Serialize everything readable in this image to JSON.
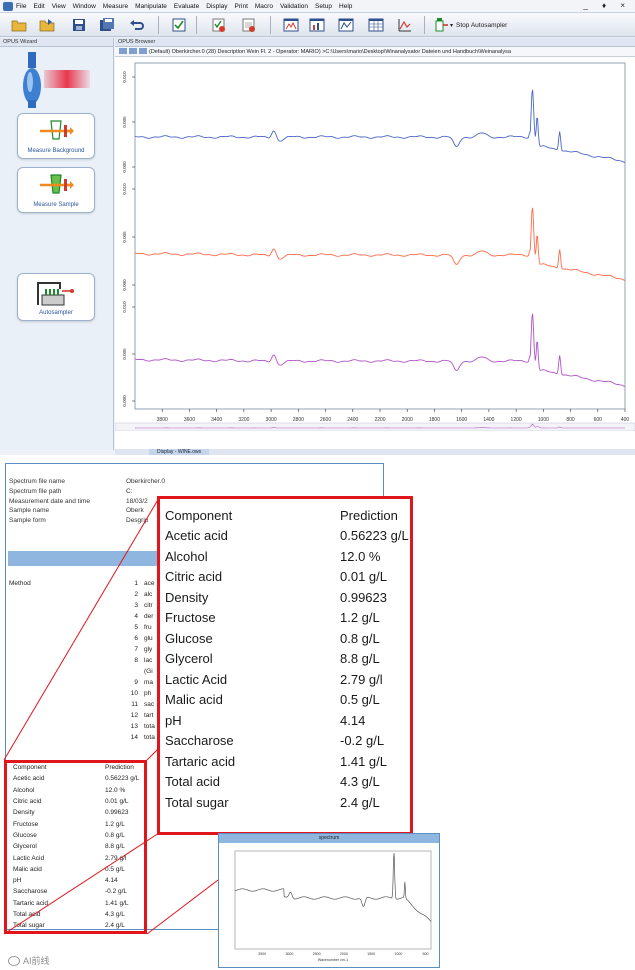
{
  "menu": {
    "items": [
      "File",
      "Edit",
      "View",
      "Window",
      "Measure",
      "Manipulate",
      "Evaluate",
      "Display",
      "Print",
      "Macro",
      "Validation",
      "Setup",
      "Help"
    ],
    "window_controls": "_ ♦ ×"
  },
  "toolbar": {
    "stop_autosampler": "Stop Autosampler"
  },
  "wizard": {
    "title": "OPUS Wizard",
    "buttons": [
      {
        "label": "Measure Background"
      },
      {
        "label": "Measure Sample"
      },
      {
        "label": "Autosampler"
      }
    ]
  },
  "browser": {
    "title": "OPUS Browser",
    "path": "(Default) Oberkircher.0 (28) Description Wein Fl. 2 - Operator: MARIO) >C:\\Users\\mario\\Desktop\\Winanalysator Dateien und Handbuch\\Weinanalysa"
  },
  "display_tab": "Display - WINE.ows",
  "chart_data": {
    "type": "line",
    "x_ticks": [
      3800,
      3600,
      3400,
      3200,
      3000,
      2800,
      2600,
      2400,
      2200,
      2000,
      1800,
      1600,
      1400,
      1200,
      1000,
      800,
      600,
      400
    ],
    "xlim": [
      4000,
      400
    ],
    "series": [
      {
        "color": "#4a66c8",
        "y_ticks": [
          "0.010",
          "0.005",
          "0.000"
        ]
      },
      {
        "color": "#ff6a4a",
        "y_ticks": [
          "0.010",
          "0.005",
          "0.000"
        ]
      },
      {
        "color": "#b154c7",
        "y_ticks": [
          "0.010",
          "0.005",
          "0.000"
        ]
      }
    ]
  },
  "report": {
    "meta_labels": [
      "Spectrum file name",
      "Spectrum file path",
      "Measurement date and time",
      "Sample name",
      "Sample form"
    ],
    "meta_values": [
      "Oberkircher.0",
      "C:",
      "18/03/2",
      "Oberk",
      "Desgrip"
    ],
    "method_label": "Method",
    "method_items": [
      {
        "num": "1",
        "text": "ace"
      },
      {
        "num": "2",
        "text": "alc"
      },
      {
        "num": "3",
        "text": "citr"
      },
      {
        "num": "4",
        "text": "der"
      },
      {
        "num": "5",
        "text": "fru"
      },
      {
        "num": "6",
        "text": "glu"
      },
      {
        "num": "7",
        "text": "gly"
      },
      {
        "num": "8",
        "text": "lac"
      },
      {
        "num": "",
        "text": "(Gi"
      },
      {
        "num": "9",
        "text": "ma"
      },
      {
        "num": "10",
        "text": "ph"
      },
      {
        "num": "11",
        "text": "sac"
      },
      {
        "num": "12",
        "text": "tart"
      },
      {
        "num": "13",
        "text": "tota"
      },
      {
        "num": "14",
        "text": "tota"
      }
    ]
  },
  "predictions": {
    "header": {
      "component": "Component",
      "prediction": "Prediction"
    },
    "rows": [
      {
        "component": "Acetic acid",
        "prediction": "0.56223 g/L"
      },
      {
        "component": "Alcohol",
        "prediction": "12.0 %"
      },
      {
        "component": "Citric acid",
        "prediction": "0.01 g/L"
      },
      {
        "component": "Density",
        "prediction": "0.99623"
      },
      {
        "component": "Fructose",
        "prediction": "1.2 g/L"
      },
      {
        "component": "Glucose",
        "prediction": "0.8 g/L"
      },
      {
        "component": "Glycerol",
        "prediction": "8.8 g/L"
      },
      {
        "component": "Lactic Acid",
        "prediction": "2.79 g/l"
      },
      {
        "component": "Malic acid",
        "prediction": "0.5 g/L"
      },
      {
        "component": "pH",
        "prediction": "4.14"
      },
      {
        "component": "Saccharose",
        "prediction": "-0.2 g/L"
      },
      {
        "component": "Tartaric acid",
        "prediction": "1.41 g/L"
      },
      {
        "component": "Total acid",
        "prediction": "4.3 g/L"
      },
      {
        "component": "Total sugar",
        "prediction": "2.4 g/L"
      }
    ]
  },
  "inset": {
    "title": "spectrum",
    "x_ticks": [
      "3500",
      "3000",
      "2500",
      "2000",
      "1500",
      "1000",
      "500"
    ],
    "x_label": "Wavenumber cm-1"
  },
  "watermark": "AI前线"
}
